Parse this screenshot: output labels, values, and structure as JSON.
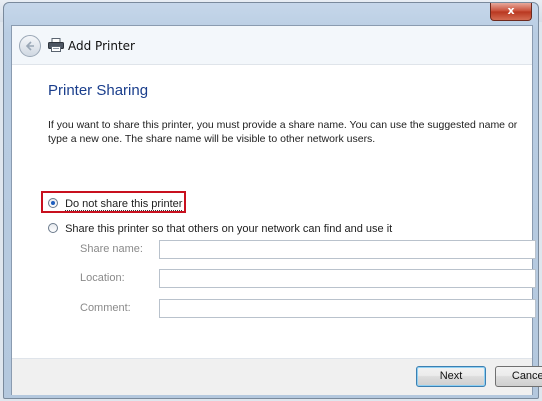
{
  "window": {
    "background_text": "... ... ... ... ... ... ...",
    "close_label": "x",
    "title": "Add Printer"
  },
  "page": {
    "section_title": "Printer Sharing",
    "description": "If you want to share this printer, you must provide a share name. You can use the suggested name or type a new one. The share name will be visible to other network users."
  },
  "options": {
    "no_share_label": "Do not share this printer",
    "share_label": "Share this printer so that others on your network can find and use it",
    "selected": "no_share"
  },
  "fields": {
    "share_name": {
      "label": "Share name:",
      "value": ""
    },
    "location": {
      "label": "Location:",
      "value": ""
    },
    "comment": {
      "label": "Comment:",
      "value": ""
    }
  },
  "buttons": {
    "next_label": "Next",
    "cancel_label": "Cancel"
  },
  "colors": {
    "accent_title": "#1a3e8c",
    "highlight_box": "#c8101e",
    "close_button": "#c74a33"
  },
  "icons": [
    "back-arrow-icon",
    "printer-icon",
    "close-icon"
  ]
}
